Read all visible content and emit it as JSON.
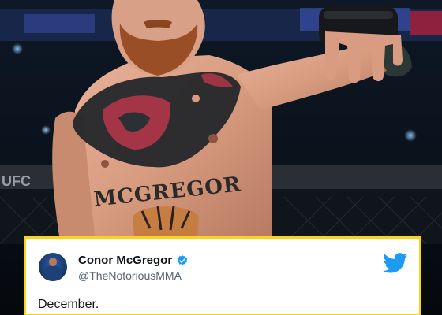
{
  "tweet": {
    "display_name": "Conor McGregor",
    "handle": "@TheNotoriousMMA",
    "text": "December.",
    "verified": true
  },
  "photo": {
    "chest_tattoo": "MCGREGOR"
  },
  "icons": {
    "verified": "verified-badge-icon",
    "brand": "twitter-bird-icon"
  },
  "colors": {
    "card_border": "#ffd21a",
    "twitter_blue": "#1d9bf0",
    "verified_blue": "#1d9bf0"
  }
}
